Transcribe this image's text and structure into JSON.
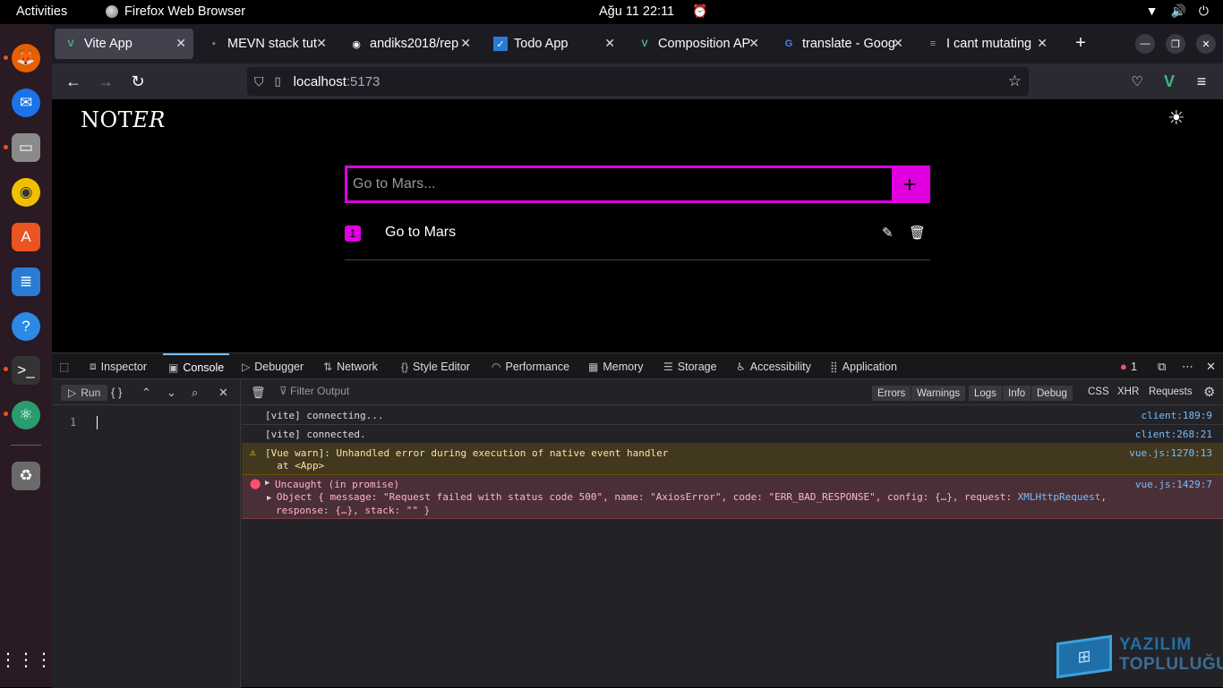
{
  "system": {
    "activities": "Activities",
    "app_name": "Firefox Web Browser",
    "clock": "Ağu 11  22:11"
  },
  "dock": {
    "apps": [
      "firefox-icon",
      "thunderbird-icon",
      "files-icon",
      "rhythmbox-icon",
      "software-icon",
      "writer-icon",
      "help-icon",
      "terminal-icon",
      "atom-icon",
      "trash-icon",
      "app-grid-icon"
    ]
  },
  "browser": {
    "tabs": [
      {
        "label": "Vite App",
        "favicon": "V"
      },
      {
        "label": "MEVN stack tut",
        "favicon": "▪"
      },
      {
        "label": "andiks2018/rep",
        "favicon": "◉"
      },
      {
        "label": "Todo App",
        "favicon": "✓"
      },
      {
        "label": "Composition AP",
        "favicon": "V"
      },
      {
        "label": "translate - Goog",
        "favicon": "G"
      },
      {
        "label": "I cant mutating",
        "favicon": "≡"
      }
    ],
    "new_tab": "+",
    "url_host": "localhost",
    "url_port": ":5173"
  },
  "page": {
    "logo_main": "NOT",
    "logo_italic": "ER",
    "input_placeholder": "Go to Mars...",
    "add_label": "+",
    "todos": [
      {
        "number": "1",
        "text": "Go to Mars"
      }
    ]
  },
  "devtools": {
    "tabs": [
      "Inspector",
      "Console",
      "Debugger",
      "Network",
      "Style Editor",
      "Performance",
      "Memory",
      "Storage",
      "Accessibility",
      "Application"
    ],
    "error_count": "1",
    "run_label": "Run",
    "braces_label": "{ }",
    "line_number": "1",
    "filter_placeholder": "Filter Output",
    "levels": [
      "Errors",
      "Warnings",
      "Logs",
      "Info",
      "Debug"
    ],
    "extra_filters": [
      "CSS",
      "XHR",
      "Requests"
    ],
    "messages": [
      {
        "text": "[vite] connecting...",
        "loc": "client:189:9"
      },
      {
        "text": "[vite] connected.",
        "loc": "client:268:21"
      },
      {
        "text": "[Vue warn]: Unhandled error during execution of native event handler\n  at <App>",
        "loc": "vue.js:1270:13"
      },
      {
        "text": "Uncaught (in promise)",
        "loc": "vue.js:1429:7"
      }
    ],
    "error_detail_line1_a": "Object { message: \"Request failed with status code 500\", name: \"AxiosError\", code: \"ERR_BAD_RESPONSE\", config: {…}, request: ",
    "error_detail_line1_b": "XMLHttpRequest",
    "error_detail_line1_c": ",",
    "error_detail_line2": "response: {…}, stack: \"\" }"
  },
  "watermark": {
    "top": "YAZILIM",
    "bottom": "TOPLULUĞU"
  },
  "colors": {
    "accent": "#e000e0",
    "devtools_link": "#75bfff"
  }
}
